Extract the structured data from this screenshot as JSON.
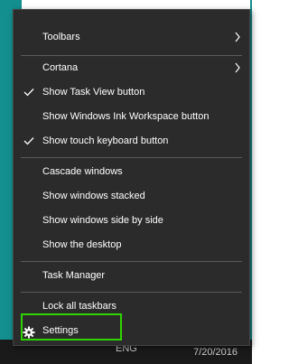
{
  "taskbar": {
    "language": "ENG",
    "date": "7/20/2016"
  },
  "menu": {
    "items": [
      {
        "label": "Toolbars"
      },
      {
        "label": "Cortana"
      },
      {
        "label": "Show Task View button"
      },
      {
        "label": "Show Windows Ink Workspace button"
      },
      {
        "label": "Show touch keyboard button"
      },
      {
        "label": "Cascade windows"
      },
      {
        "label": "Show windows stacked"
      },
      {
        "label": "Show windows side by side"
      },
      {
        "label": "Show the desktop"
      },
      {
        "label": "Task Manager"
      },
      {
        "label": "Lock all taskbars"
      },
      {
        "label": "Settings"
      }
    ]
  },
  "colors": {
    "menu_background": "#2b2b2b",
    "text": "#ffffff",
    "highlight_border": "#2fd400",
    "desktop_accent": "#148f8f"
  }
}
